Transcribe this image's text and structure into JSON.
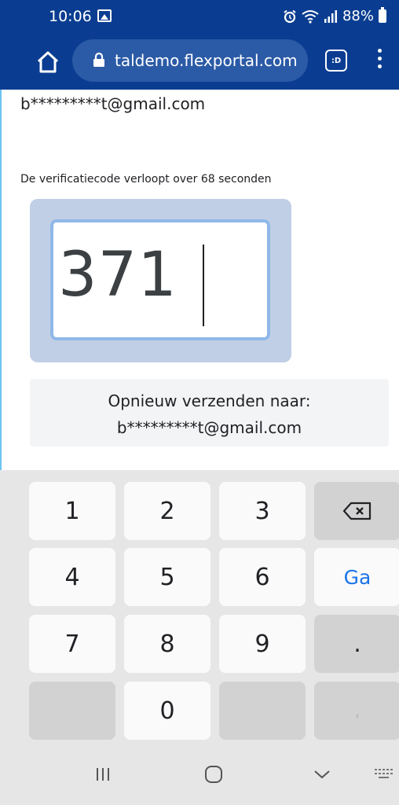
{
  "status_bar": {
    "time": "10:06",
    "battery": "88%",
    "icons": [
      "gallery-icon",
      "alarm-icon",
      "wifi-icon",
      "signal-icon",
      "battery-icon"
    ]
  },
  "browser": {
    "url": "taldemo.flexportal.com",
    "tabs_badge": ":D",
    "icons": [
      "home-icon",
      "lock-icon",
      "tabs-icon",
      "menu-icon"
    ]
  },
  "page": {
    "masked_email": "b*********t@gmail.com",
    "expiry_text": "De verificatiecode verloopt over 68 seconden",
    "code_value": "371",
    "resend_label": "Opnieuw verzenden naar:",
    "resend_email": "b*********t@gmail.com"
  },
  "keyboard": {
    "keys": [
      "1",
      "2",
      "3",
      "4",
      "5",
      "6",
      "7",
      "8",
      "9",
      "0"
    ],
    "go_label": "Ga",
    "dot_label": ".",
    "comma_label": ",",
    "backspace_icon": "backspace-icon"
  },
  "navigation": {
    "icons": [
      "recent-apps-icon",
      "home-nav-icon",
      "back-icon",
      "keyboard-switch-icon"
    ]
  },
  "colors": {
    "toolbar": "#0a3d91",
    "url_pill": "#2b5aa6",
    "code_card": "#c1cfe6",
    "input_border": "#8fb8e8",
    "go_key": "#1a73e8"
  }
}
